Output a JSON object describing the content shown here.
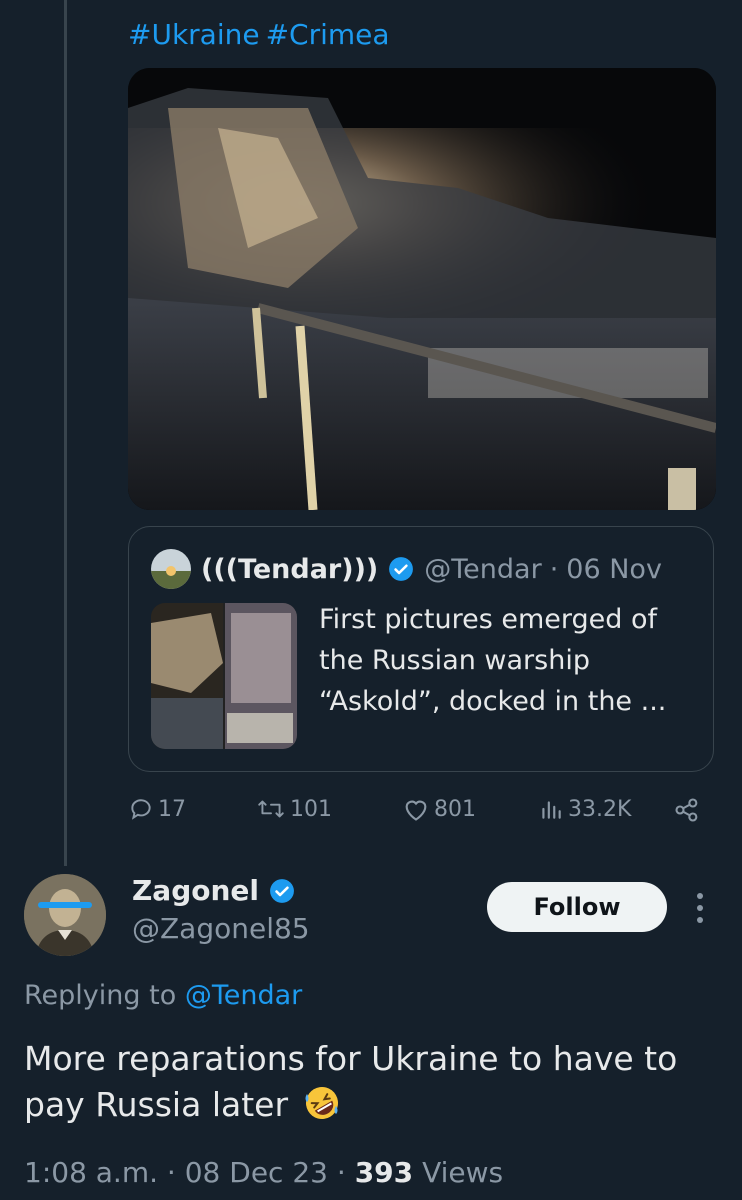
{
  "tweet": {
    "hashtags": [
      "#Ukraine",
      "#Crimea"
    ],
    "actions": {
      "replies": "17",
      "retweets": "101",
      "likes": "801",
      "views": "33.2K"
    }
  },
  "quote": {
    "name": "(((Tendar)))",
    "handle": "@Tendar",
    "sep": "·",
    "date": "06 Nov",
    "text": "First pictures emerged of the Russian warship “Askold”, docked in the ..."
  },
  "reply": {
    "name": "Zagonel",
    "handle": "@Zagonel85",
    "follow_label": "Follow",
    "replying_prefix": "Replying to",
    "replying_handle": "@Tendar",
    "text": "More reparations for Ukraine to have to pay Russia later",
    "emoji": "rolling-on-floor-laughing-emoji",
    "time": "1:08 a.m.",
    "sep": "·",
    "date": "08 Dec 23",
    "views_count": "393",
    "views_label": "Views"
  },
  "colors": {
    "background": "#15202b",
    "accent": "#1d9bf0",
    "muted": "#8b98a5",
    "text": "#e7e9ea"
  }
}
